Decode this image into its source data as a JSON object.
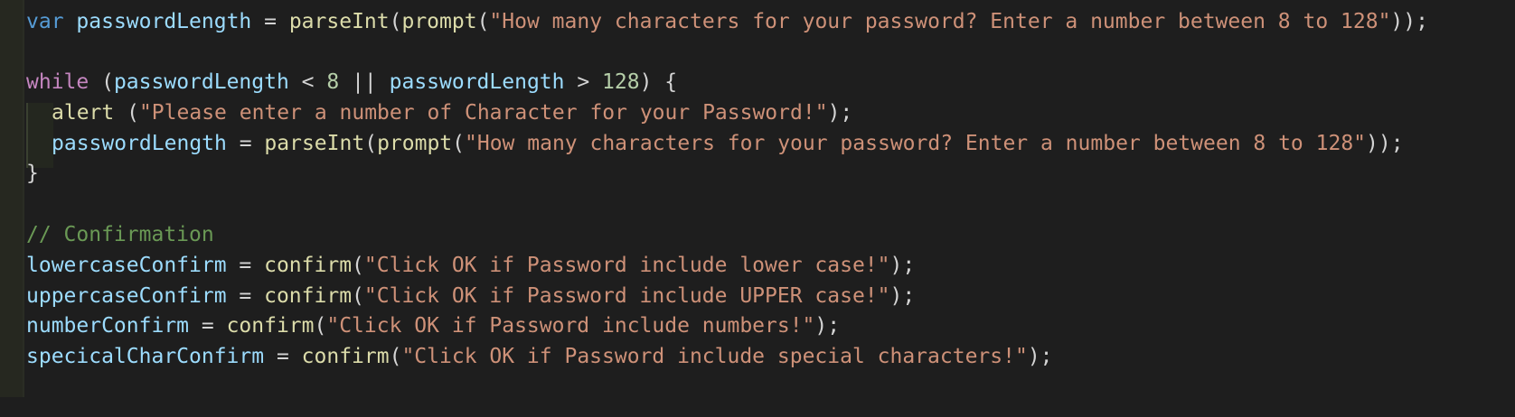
{
  "code": {
    "line1": {
      "kw": "var",
      "var": "passwordLength",
      "eq": " = ",
      "fn1": "parseInt",
      "p1": "(",
      "fn2": "prompt",
      "p2": "(",
      "str": "\"How many characters for your password? Enter a number between 8 to 128\"",
      "end": "));"
    },
    "line3": {
      "kw": "while",
      "p1": " (",
      "var1": "passwordLength",
      "op1": " < ",
      "num1": "8",
      "op2": " || ",
      "var2": "passwordLength",
      "op3": " > ",
      "num2": "128",
      "end": ") {"
    },
    "line4": {
      "fn": "alert",
      "p1": " (",
      "str": "\"Please enter a number of Character for your Password!\"",
      "end": ");"
    },
    "line5": {
      "var": "passwordLength",
      "eq": " = ",
      "fn1": "parseInt",
      "p1": "(",
      "fn2": "prompt",
      "p2": "(",
      "str": "\"How many characters for your password? Enter a number between 8 to 128\"",
      "end": "));"
    },
    "line6": {
      "brace": "}"
    },
    "line8": {
      "comment": "// Confirmation"
    },
    "line9": {
      "var": "lowercaseConfirm",
      "eq": " = ",
      "fn": "confirm",
      "p": "(",
      "str": "\"Click OK if Password include lower case!\"",
      "end": ");"
    },
    "line10": {
      "var": "uppercaseConfirm",
      "eq": " = ",
      "fn": "confirm",
      "p": "(",
      "str": "\"Click OK if Password include UPPER case!\"",
      "end": ");"
    },
    "line11": {
      "var": "numberConfirm",
      "eq": " = ",
      "fn": "confirm",
      "p": "(",
      "str": "\"Click OK if Password include numbers!\"",
      "end": ");"
    },
    "line12": {
      "var": "specicalCharConfirm",
      "eq": " = ",
      "fn": "confirm",
      "p": "(",
      "str": "\"Click OK if Password include special characters!\"",
      "end": ");"
    }
  },
  "colors": {
    "background": "#1e1e1e",
    "keyword_storage": "#569cd6",
    "keyword_control": "#c586c0",
    "variable": "#9cdcfe",
    "function": "#dcdcaa",
    "string": "#ce9178",
    "number": "#b5cea8",
    "comment": "#6a9955"
  }
}
